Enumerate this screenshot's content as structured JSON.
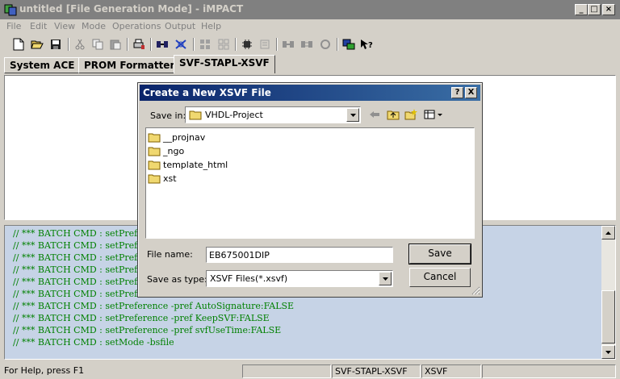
{
  "window": {
    "title": "untitled [File Generation Mode] - iMPACT"
  },
  "menu": [
    "File",
    "Edit",
    "View",
    "Mode",
    "Operations",
    "Output",
    "Help"
  ],
  "toolbar": [
    "new-icon",
    "open-icon",
    "save-icon",
    "cut-icon",
    "copy-icon",
    "paste-icon",
    "print-icon",
    "chain-icon",
    "chain-x-icon",
    "grid-icon",
    "grid2-icon",
    "chip-icon",
    "chip2-icon",
    "chain2-icon",
    "chain3-icon",
    "chain4-icon",
    "device-icon",
    "help-icon"
  ],
  "tabs": [
    "System ACE",
    "PROM Formatter",
    "SVF-STAPL-XSVF"
  ],
  "active_tab": 2,
  "console": {
    "lines": [
      "// *** BATCH CMD : setPrefere",
      "// *** BATCH CMD : setPrefere",
      "// *** BATCH CMD : setPrefere",
      "// *** BATCH CMD : setPrefere",
      "// *** BATCH CMD : setPrefere",
      "// *** BATCH CMD : setPrefere",
      "// *** BATCH CMD : setPreference -pref AutoSignature:FALSE",
      "// *** BATCH CMD : setPreference -pref KeepSVF:FALSE",
      "// *** BATCH CMD : setPreference -pref svfUseTime:FALSE",
      "// *** BATCH CMD : setMode -bsfile"
    ]
  },
  "status": {
    "help": "For Help, press F1",
    "mode": "SVF-STAPL-XSVF",
    "type": "XSVF"
  },
  "dialog": {
    "title": "Create a New XSVF File",
    "help_btn": "?",
    "close_btn": "X",
    "save_in_label": "Save in:",
    "save_in_value": "VHDL-Project",
    "files": [
      "__projnav",
      "_ngo",
      "template_html",
      "xst"
    ],
    "file_name_label": "File name:",
    "file_name_value": "EB675001DIP",
    "save_type_label": "Save as type:",
    "save_type_value": "XSVF Files(*.xsvf)",
    "save_button": "Save",
    "cancel_button": "Cancel"
  },
  "colors": {
    "console_bg": "#c6d3e6",
    "console_text": "#008000",
    "title_active_start": "#0a246a",
    "title_active_end": "#3a6ea5"
  }
}
